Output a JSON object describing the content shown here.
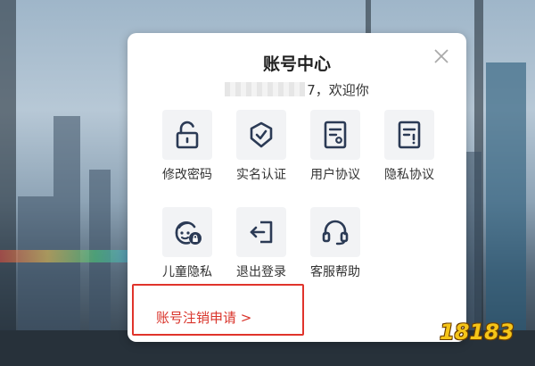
{
  "dialog": {
    "title": "账号中心",
    "welcome_suffix": "7，欢迎你"
  },
  "menu_items": [
    {
      "label": "修改密码",
      "icon": "unlock-icon"
    },
    {
      "label": "实名认证",
      "icon": "shield-check-icon"
    },
    {
      "label": "用户协议",
      "icon": "document-icon"
    },
    {
      "label": "隐私协议",
      "icon": "document-alert-icon"
    },
    {
      "label": "儿童隐私",
      "icon": "child-face-lock-icon"
    },
    {
      "label": "退出登录",
      "icon": "logout-icon"
    },
    {
      "label": "客服帮助",
      "icon": "headset-icon"
    }
  ],
  "cancel_account": {
    "label": "账号注销申请",
    "arrow": ">"
  },
  "watermark": {
    "text": "18183"
  },
  "colors": {
    "icon": "#2b3a55",
    "accent_red": "#e0342b",
    "tile_bg": "#f2f3f5"
  }
}
